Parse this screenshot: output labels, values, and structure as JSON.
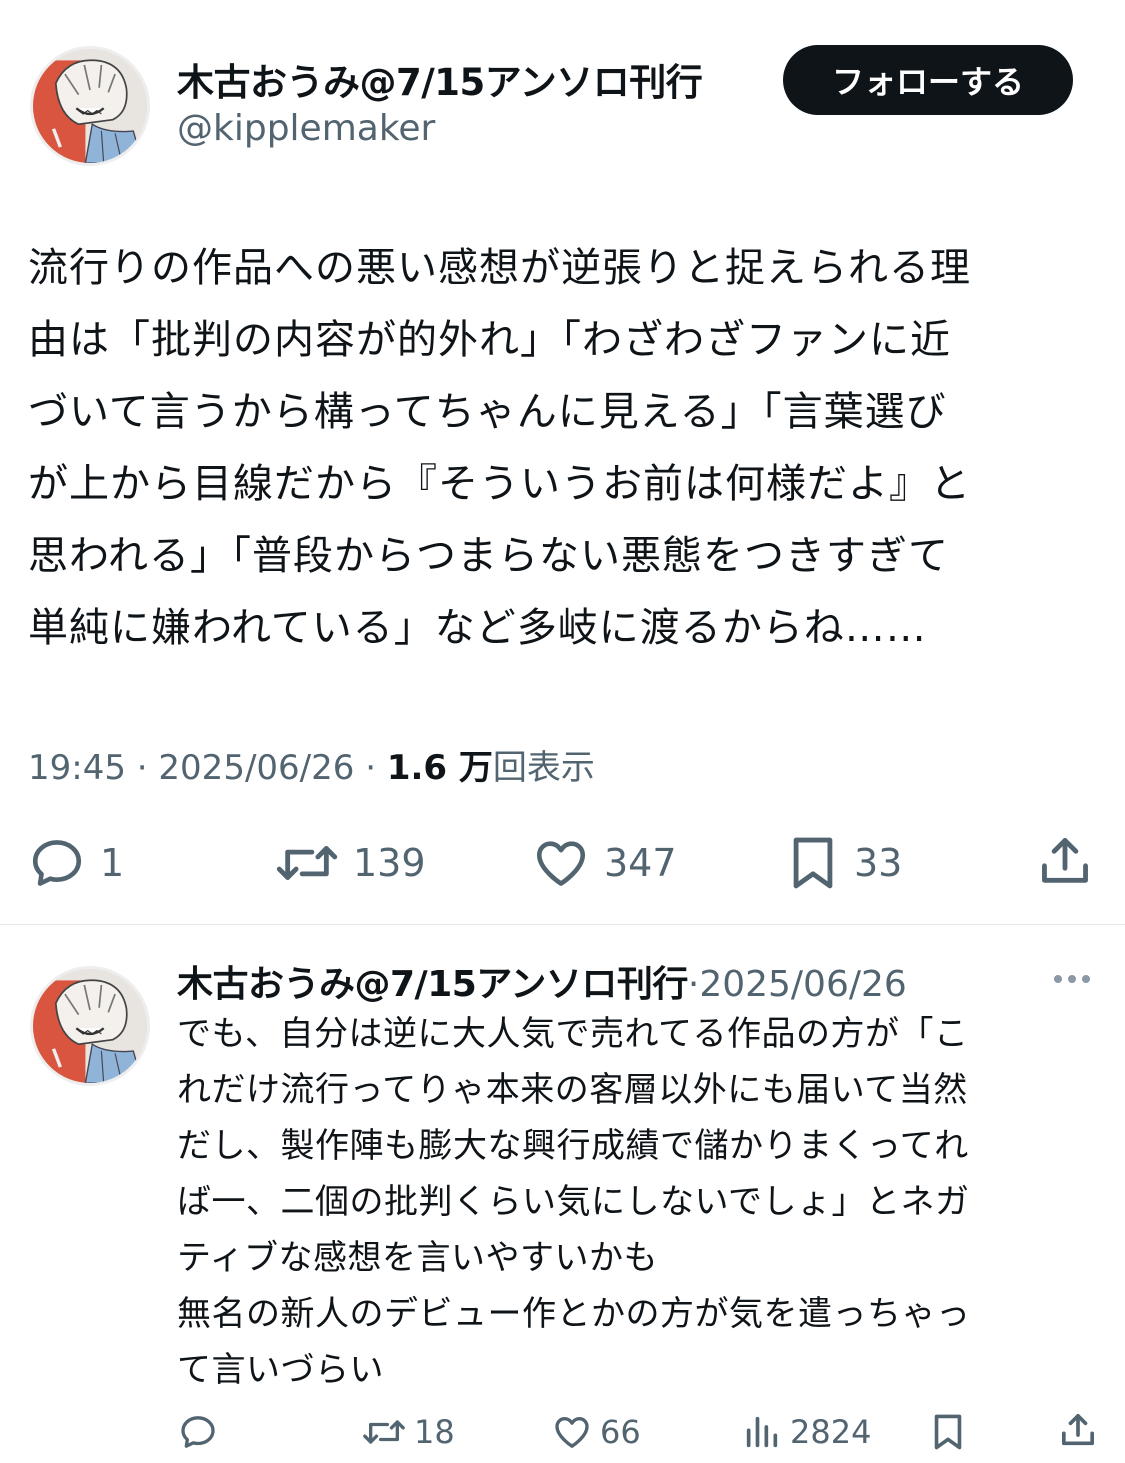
{
  "tweet": {
    "author": {
      "display_name": "木古おうみ@7/15アンソロ刊行",
      "handle": "@kipplemaker",
      "avatar_icon": "user-avatar-illustration"
    },
    "follow_label": "フォローする",
    "text_lines": [
      "流行りの作品への悪い感想が逆張りと捉えられる理",
      "由は「批判の内容が的外れ」「わざわざファンに近",
      "づいて言うから構ってちゃんに見える」「言葉選び",
      "が上から目線だから『そういうお前は何様だよ』と",
      "思われる」「普段からつまらない悪態をつきすぎて",
      "単純に嫌われている」など多岐に渡るからね……"
    ],
    "meta": {
      "time": "19:45",
      "date": "2025/06/26",
      "separator": "·",
      "views_number": "1.6 万",
      "views_label": "回表示"
    },
    "actions": {
      "replies": "1",
      "retweets": "139",
      "likes": "347",
      "bookmarks": "33"
    }
  },
  "reply": {
    "author": {
      "display_name": "木古おうみ@7/15アンソロ刊行",
      "avatar_icon": "user-avatar-illustration"
    },
    "separator": "·",
    "date": "2025/06/26",
    "more_icon": "more-dots-icon",
    "text_lines": [
      "でも、自分は逆に大人気で売れてる作品の方が「こ",
      "れだけ流行ってりゃ本来の客層以外にも届いて当然",
      "だし、製作陣も膨大な興行成績で儲かりまくってれ",
      "ば一、二個の批判くらい気にしないでしょ」とネガ",
      "ティブな感想を言いやすいかも",
      "無名の新人のデビュー作とかの方が気を遣っちゃっ",
      "て言いづらい"
    ],
    "actions": {
      "replies": "",
      "retweets": "18",
      "likes": "66",
      "views": "2824"
    }
  },
  "colors": {
    "text_primary": "#0f1419",
    "text_secondary": "#536471",
    "button_bg": "#0f1419",
    "avatar_accent": "#d9553f"
  }
}
